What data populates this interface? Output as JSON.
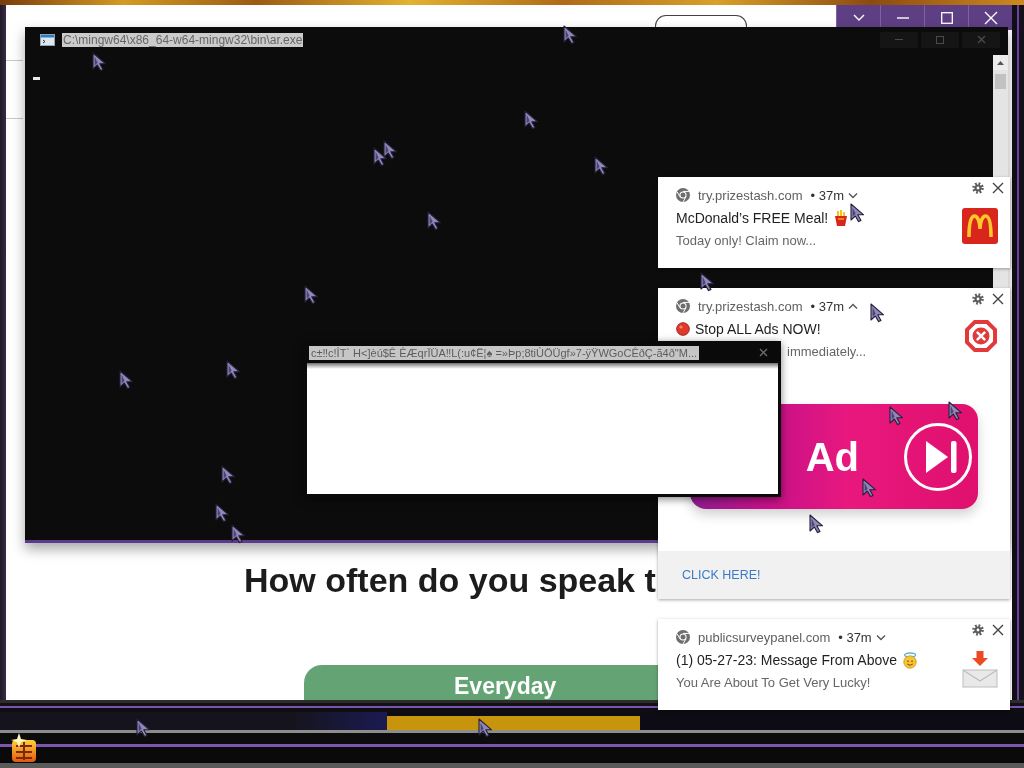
{
  "browser": {
    "heading": "How often do you speak t",
    "answer_button": "Everyday"
  },
  "console": {
    "title": "C:\\mingw64\\x86_64-w64-mingw32\\bin\\ar.exe"
  },
  "dialog": {
    "title": "c±‼c!ÎT` H<]èú$Ê ÊÆqrÏÜA‼L(:u¢Ë¦♠ =»Þp;8tiÙÖÜgf»7-ÿŸWGoCÊðÇ-ã4ð\"M..."
  },
  "notifications": [
    {
      "site": "try.prizestash.com",
      "time": "• 37m",
      "expanded": false,
      "title": "McDonald’s FREE Meal!",
      "body": "Today only! Claim now..."
    },
    {
      "site": "try.prizestash.com",
      "time": "• 37m",
      "expanded": true,
      "title": "Stop ALL Ads NOW!",
      "body": "immediately...",
      "banner_text": "Ad",
      "action": "CLICK HERE!"
    },
    {
      "site": "publicsurveypanel.com",
      "time": "• 37m",
      "expanded": false,
      "title": "(1) 05-27-23: Message From Above",
      "body": "You Are About To Get Very Lucky!"
    }
  ]
}
